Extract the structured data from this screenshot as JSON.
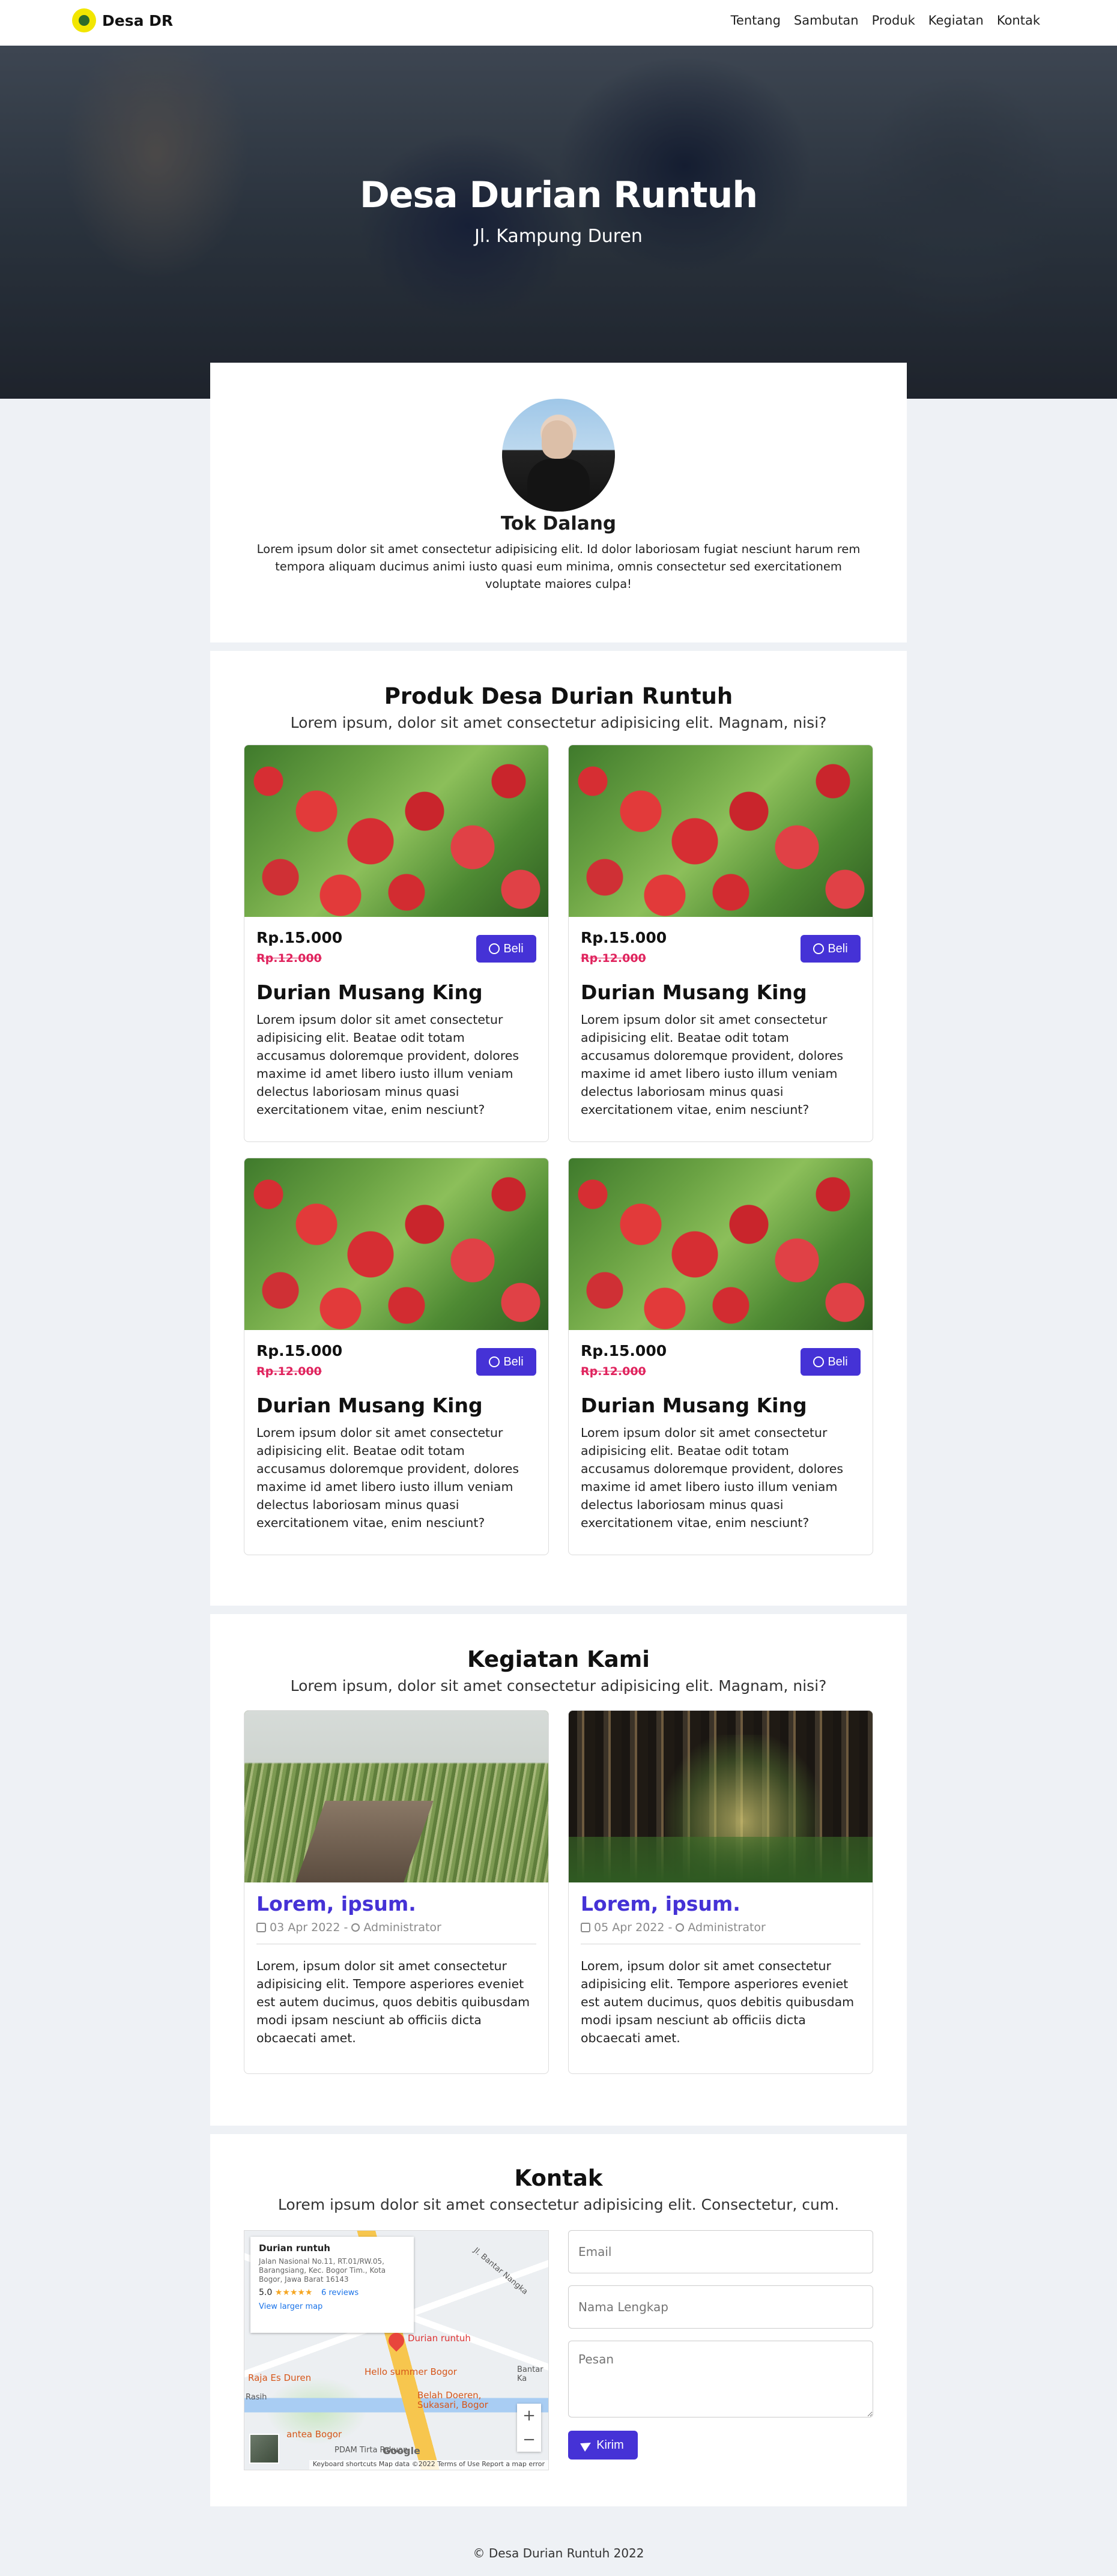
{
  "nav": {
    "brand": "Desa DR",
    "links": [
      "Tentang",
      "Sambutan",
      "Produk",
      "Kegiatan",
      "Kontak"
    ]
  },
  "hero": {
    "title": "Desa Durian Runtuh",
    "subtitle": "Jl. Kampung Duren"
  },
  "welcome": {
    "name": "Tok Dalang",
    "text": "Lorem ipsum dolor sit amet consectetur adipisicing elit. Id dolor laboriosam fugiat nesciunt harum rem tempora aliquam ducimus animi iusto quasi eum minima, omnis consectetur sed exercitationem voluptate maiores culpa!"
  },
  "products": {
    "title": "Produk Desa Durian Runtuh",
    "subtitle": "Lorem ipsum, dolor sit amet consectetur adipisicing elit. Magnam, nisi?",
    "buy_label": "Beli",
    "items": [
      {
        "price": "Rp.15.000",
        "old_price": "Rp.12.000",
        "name": "Durian Musang King",
        "desc": "Lorem ipsum dolor sit amet consectetur adipisicing elit. Beatae odit totam accusamus doloremque provident, dolores maxime id amet libero iusto illum veniam delectus laboriosam minus quasi exercitationem vitae, enim nesciunt?"
      },
      {
        "price": "Rp.15.000",
        "old_price": "Rp.12.000",
        "name": "Durian Musang King",
        "desc": "Lorem ipsum dolor sit amet consectetur adipisicing elit. Beatae odit totam accusamus doloremque provident, dolores maxime id amet libero iusto illum veniam delectus laboriosam minus quasi exercitationem vitae, enim nesciunt?"
      },
      {
        "price": "Rp.15.000",
        "old_price": "Rp.12.000",
        "name": "Durian Musang King",
        "desc": "Lorem ipsum dolor sit amet consectetur adipisicing elit. Beatae odit totam accusamus doloremque provident, dolores maxime id amet libero iusto illum veniam delectus laboriosam minus quasi exercitationem vitae, enim nesciunt?"
      },
      {
        "price": "Rp.15.000",
        "old_price": "Rp.12.000",
        "name": "Durian Musang King",
        "desc": "Lorem ipsum dolor sit amet consectetur adipisicing elit. Beatae odit totam accusamus doloremque provident, dolores maxime id amet libero iusto illum veniam delectus laboriosam minus quasi exercitationem vitae, enim nesciunt?"
      }
    ]
  },
  "activities": {
    "title": "Kegiatan Kami",
    "subtitle": "Lorem ipsum, dolor sit amet consectetur adipisicing elit. Magnam, nisi?",
    "items": [
      {
        "title": "Lorem, ipsum.",
        "date": "03 Apr 2022",
        "author": "Administrator",
        "desc": "Lorem, ipsum dolor sit amet consectetur adipisicing elit. Tempore asperiores eveniet est autem ducimus, quos debitis quibusdam modi ipsam nesciunt ab officiis dicta obcaecati amet."
      },
      {
        "title": "Lorem, ipsum.",
        "date": "05 Apr 2022",
        "author": "Administrator",
        "desc": "Lorem, ipsum dolor sit amet consectetur adipisicing elit. Tempore asperiores eveniet est autem ducimus, quos debitis quibusdam modi ipsam nesciunt ab officiis dicta obcaecati amet."
      }
    ]
  },
  "contact": {
    "title": "Kontak",
    "subtitle": "Lorem ipsum dolor sit amet consectetur adipisicing elit. Consectetur, cum.",
    "email_placeholder": "Email",
    "name_placeholder": "Nama Lengkap",
    "message_placeholder": "Pesan",
    "submit_label": "Kirim",
    "map": {
      "place": "Durian runtuh",
      "address": "Jalan Nasional No.11, RT.01/RW.05, Barangsiang, Kec. Bogor Tim., Kota Bogor, Jawa Barat 16143",
      "rating": "5.0",
      "stars": "★★★★★",
      "reviews": "6 reviews",
      "larger_map": "View larger map",
      "pin_label": "Durian runtuh",
      "label_1": "Raja Es Duren",
      "label_2": "Hello summer Bogor",
      "label_3": "Belah Doeren, Sukasari, Bogor",
      "label_4": "antea Bogor",
      "label_5": "PDAM Tirta Pakuan",
      "label_6": "Bantar Ka",
      "label_7": "Jl. Bantar Nangka",
      "label_8": "Rasih",
      "google": "Google",
      "footer": "Keyboard shortcuts   Map data ©2022   Terms of Use   Report a map error"
    }
  },
  "footer": {
    "text": "© Desa Durian Runtuh 2022"
  }
}
